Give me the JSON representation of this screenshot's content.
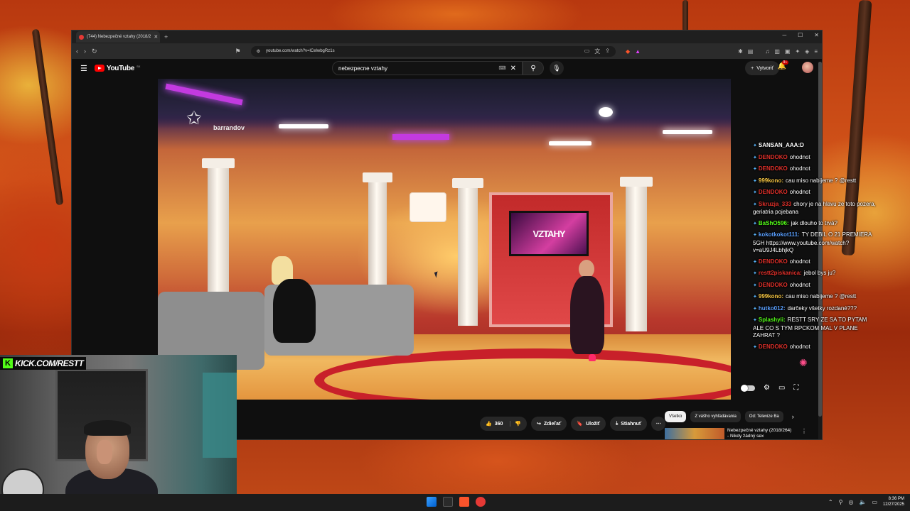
{
  "browser": {
    "tab_title": "(744) Nebezpečné vztahy (2018/2",
    "url": "youtube.com/watch?v=lCelwbgRz1s"
  },
  "youtube": {
    "logo_text": "YouTube",
    "country_code": "SK",
    "search_value": "nebezpecne vztahy",
    "create_label": "Vytvoriť",
    "notification_count": "9+",
    "actions": {
      "like_count": "360",
      "share_label": "Zdieľať",
      "save_label": "Uložiť",
      "download_label": "Stiahnuť"
    },
    "chips": [
      "Všetko",
      "Z vášho vyhľadávania",
      "Od: Televize Ba"
    ],
    "recommendation": {
      "title_line1": "Nebezpečné vztahy (2018/264)",
      "title_line2": "- Nikdy žádný sex"
    }
  },
  "video": {
    "channel_logo_text": "barrandov",
    "tv_screen_text": "VZTAHY"
  },
  "chat": [
    {
      "user": "SANSAN_AAA:D",
      "text": "",
      "color": "#ffffff"
    },
    {
      "user": "DENDOKO",
      "text": "ohodnot",
      "color": "#e0302a"
    },
    {
      "user": "DENDOKO",
      "text": "ohodnot",
      "color": "#e0302a"
    },
    {
      "user": "999kono:",
      "text": "cau miso nabijeme ? @restt",
      "color": "#f5c542"
    },
    {
      "user": "DENDOKO",
      "text": "ohodnot",
      "color": "#e0302a"
    },
    {
      "user": "Skruzja_333",
      "text": "chory je na hlavu ze toto pozera, geriatria pojebana",
      "color": "#e0302a"
    },
    {
      "user": "BaShO596:",
      "text": "jak dlouho to trvá?",
      "color": "#53fc18"
    },
    {
      "user": "kokotkokot111:",
      "text": "TY DEBIL O 21 PREMIERA 5GH https://www.youtube.com/watch?v=aU9J4LbhjkQ",
      "color": "#5aa0ff"
    },
    {
      "user": "DENDOKO",
      "text": "ohodnot",
      "color": "#e0302a"
    },
    {
      "user": "restt2piskanica:",
      "text": "jebol bys ju?",
      "color": "#e0302a"
    },
    {
      "user": "DENDOKO",
      "text": "ohodnot",
      "color": "#e0302a"
    },
    {
      "user": "999kono:",
      "text": "cau miso nabijeme ? @restt",
      "color": "#f5c542"
    },
    {
      "user": "hutko012:",
      "text": "darčeky všetky rozdané???",
      "color": "#5aa0ff"
    },
    {
      "user": "Splashyii:",
      "text": "RESTT SRY ZE SA TO PYTAM ALE CO S TYM RPCKOM MAL V PLANE ZAHRAT ?",
      "color": "#53fc18"
    },
    {
      "user": "DENDOKO",
      "text": "ohodnot",
      "color": "#e0302a"
    }
  ],
  "overlay": {
    "kick_text": "KICK.COM/RESTT"
  },
  "taskbar": {
    "time": "8:36 PM",
    "date": "12/27/2025"
  }
}
